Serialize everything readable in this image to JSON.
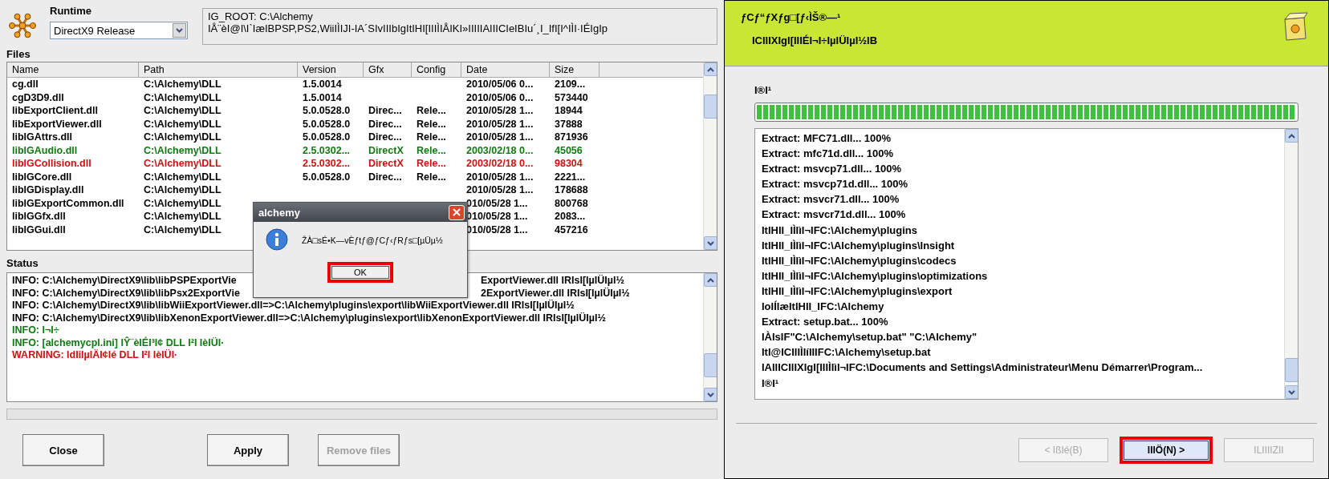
{
  "runtime": {
    "label": "Runtime",
    "value": "DirectX9 Release"
  },
  "ig_info": [
    "IG_ROOT: C:\\Alchemy",
    "IÅ¨èI@I\\I`IæIBPSP,PS2,WiiIÌIJI-IA´SIvIIIbIgItIHI[IIIÌIÅIKI»IIIIIAIIICIeIBIu´¸I_IfI[I^IÌI·IÉIgIp"
  ],
  "files": {
    "label": "Files",
    "columns": [
      "Name",
      "Path",
      "Version",
      "Gfx",
      "Config",
      "Date",
      "Size"
    ],
    "rows": [
      {
        "cells": [
          "cg.dll",
          "C:\\Alchemy\\DLL",
          "1.5.0014",
          "",
          "",
          "2010/05/06 0...",
          "2109..."
        ],
        "color": "#000000"
      },
      {
        "cells": [
          "cgD3D9.dll",
          "C:\\Alchemy\\DLL",
          "1.5.0014",
          "",
          "",
          "2010/05/06 0...",
          "573440"
        ],
        "color": "#000000"
      },
      {
        "cells": [
          "libExportClient.dll",
          "C:\\Alchemy\\DLL",
          "5.0.0528.0",
          "Direc...",
          "Rele...",
          "2010/05/28 1...",
          "18944"
        ],
        "color": "#000000"
      },
      {
        "cells": [
          "libExportViewer.dll",
          "C:\\Alchemy\\DLL",
          "5.0.0528.0",
          "Direc...",
          "Rele...",
          "2010/05/28 1...",
          "37888"
        ],
        "color": "#000000"
      },
      {
        "cells": [
          "libIGAttrs.dll",
          "C:\\Alchemy\\DLL",
          "5.0.0528.0",
          "Direc...",
          "Rele...",
          "2010/05/28 1...",
          "871936"
        ],
        "color": "#000000"
      },
      {
        "cells": [
          "libIGAudio.dll",
          "C:\\Alchemy\\DLL",
          "2.5.0302...",
          "DirectX",
          "Rele...",
          "2003/02/18 0...",
          "45056"
        ],
        "color": "#107a10"
      },
      {
        "cells": [
          "libIGCollision.dll",
          "C:\\Alchemy\\DLL",
          "2.5.0302...",
          "DirectX",
          "Rele...",
          "2003/02/18 0...",
          "98304"
        ],
        "color": "#d01010"
      },
      {
        "cells": [
          "libIGCore.dll",
          "C:\\Alchemy\\DLL",
          "5.0.0528.0",
          "Direc...",
          "Rele...",
          "2010/05/28 1...",
          "2221..."
        ],
        "color": "#000000"
      },
      {
        "cells": [
          "libIGDisplay.dll",
          "C:\\Alchemy\\DLL",
          "",
          "",
          "",
          "2010/05/28 1...",
          "178688"
        ],
        "color": "#000000"
      },
      {
        "cells": [
          "libIGExportCommon.dll",
          "C:\\Alchemy\\DLL",
          "",
          "",
          "",
          "010/05/28 1...",
          "800768"
        ],
        "color": "#000000"
      },
      {
        "cells": [
          "libIGGfx.dll",
          "C:\\Alchemy\\DLL",
          "",
          "",
          "",
          "010/05/28 1...",
          "2083..."
        ],
        "color": "#000000"
      },
      {
        "cells": [
          "libIGGui.dll",
          "C:\\Alchemy\\DLL",
          "",
          "",
          "",
          "010/05/28 1...",
          "457216"
        ],
        "color": "#000000"
      }
    ]
  },
  "status": {
    "label": "Status",
    "lines": [
      {
        "head": "INFO: C:\\Alchemy\\DirectX9\\lib\\libPSPExportVie",
        "tail": "ExportViewer.dll IRIsI[IµIÜIµI½",
        "color": "#000000"
      },
      {
        "head": "INFO: C:\\Alchemy\\DirectX9\\lib\\libPsx2ExportVie",
        "tail": "2ExportViewer.dll IRIsI[IµIÜIµI½",
        "color": "#000000"
      },
      {
        "head": "INFO: C:\\Alchemy\\DirectX9\\lib\\libWiiExportViewer.dll=>C:\\Alchemy\\plugins\\export\\libWiiExportViewer.dll IRIsI[IµIÜIµI½",
        "color": "#000000"
      },
      {
        "head": "INFO: C:\\Alchemy\\DirectX9\\lib\\libXenonExportViewer.dll=>C:\\Alchemy\\plugins\\export\\libXenonExportViewer.dll IRIsI[IµIÜIµI½",
        "color": "#000000"
      },
      {
        "head": "INFO: I¬I÷",
        "color": "#107a10"
      },
      {
        "head": "INFO: [alchemycpl.ini] IŶ¨èIÉI³I¢ DLL I²I  IèIÜI·",
        "color": "#107a10"
      },
      {
        "head": "WARNING: IdIiIµIÄI¢Ié DLL I²I  IèIÜI·",
        "color": "#d01010"
      }
    ]
  },
  "buttons": [
    {
      "label": "Close",
      "disabled": false
    },
    {
      "label": "Apply",
      "disabled": false
    },
    {
      "label": "Remove files",
      "disabled": true
    }
  ],
  "dialog": {
    "title": "alchemy",
    "message": "ŽÀ□sÉ•K—vÈƒtƒ@ƒCƒ‹ƒRƒs□[µÜµ½",
    "button": "OK"
  },
  "installer": {
    "title": "ƒCƒ“ƒXƒg□[ƒ‹ÌŠ®—¹",
    "subtitle": "ICIIIXIgI[IIIÉI¬I÷IµIÜIµI½IB",
    "progress_label": "I®I¹",
    "level": 1,
    "log": [
      "Extract: MFC71.dll... 100%",
      "Extract: mfc71d.dll... 100%",
      "Extract: msvcp71.dll... 100%",
      "Extract: msvcp71d.dll... 100%",
      "Extract: msvcr71.dll... 100%",
      "Extract: msvcr71d.dll... 100%",
      "ItIHII_IÌIìI¬IFC:\\Alchemy\\plugins",
      "ItIHII_IÌIìI¬IFC:\\Alchemy\\plugins\\Insight",
      "ItIHII_IÌIìI¬IFC:\\Alchemy\\plugins\\codecs",
      "ItIHII_IÌIìI¬IFC:\\Alchemy\\plugins\\optimizations",
      "ItIHII_IÌIìI¬IFC:\\Alchemy\\plugins\\export",
      "IoIÍIæItIHII_IFC:\\Alchemy",
      "Extract: setup.bat... 100%",
      "IÀIsIF\"C:\\Alchemy\\setup.bat\" \"C:\\Alchemy\"",
      "ItI@ICIIIÌIíIIIFC:\\Alchemy\\setup.bat",
      "IAIIICIIIXIgI[IIIÌIìI¬IFC:\\Documents and Settings\\Administrateur\\Menu Démarrer\\Program...",
      "I®I¹"
    ],
    "buttons": [
      {
        "label": "< IßIé(B)",
        "disabled": true,
        "focused": false
      },
      {
        "label": "IIIÖ(N) >",
        "disabled": false,
        "focused": true
      },
      {
        "label": "ILIIIIZII",
        "disabled": true,
        "focused": false
      }
    ]
  }
}
